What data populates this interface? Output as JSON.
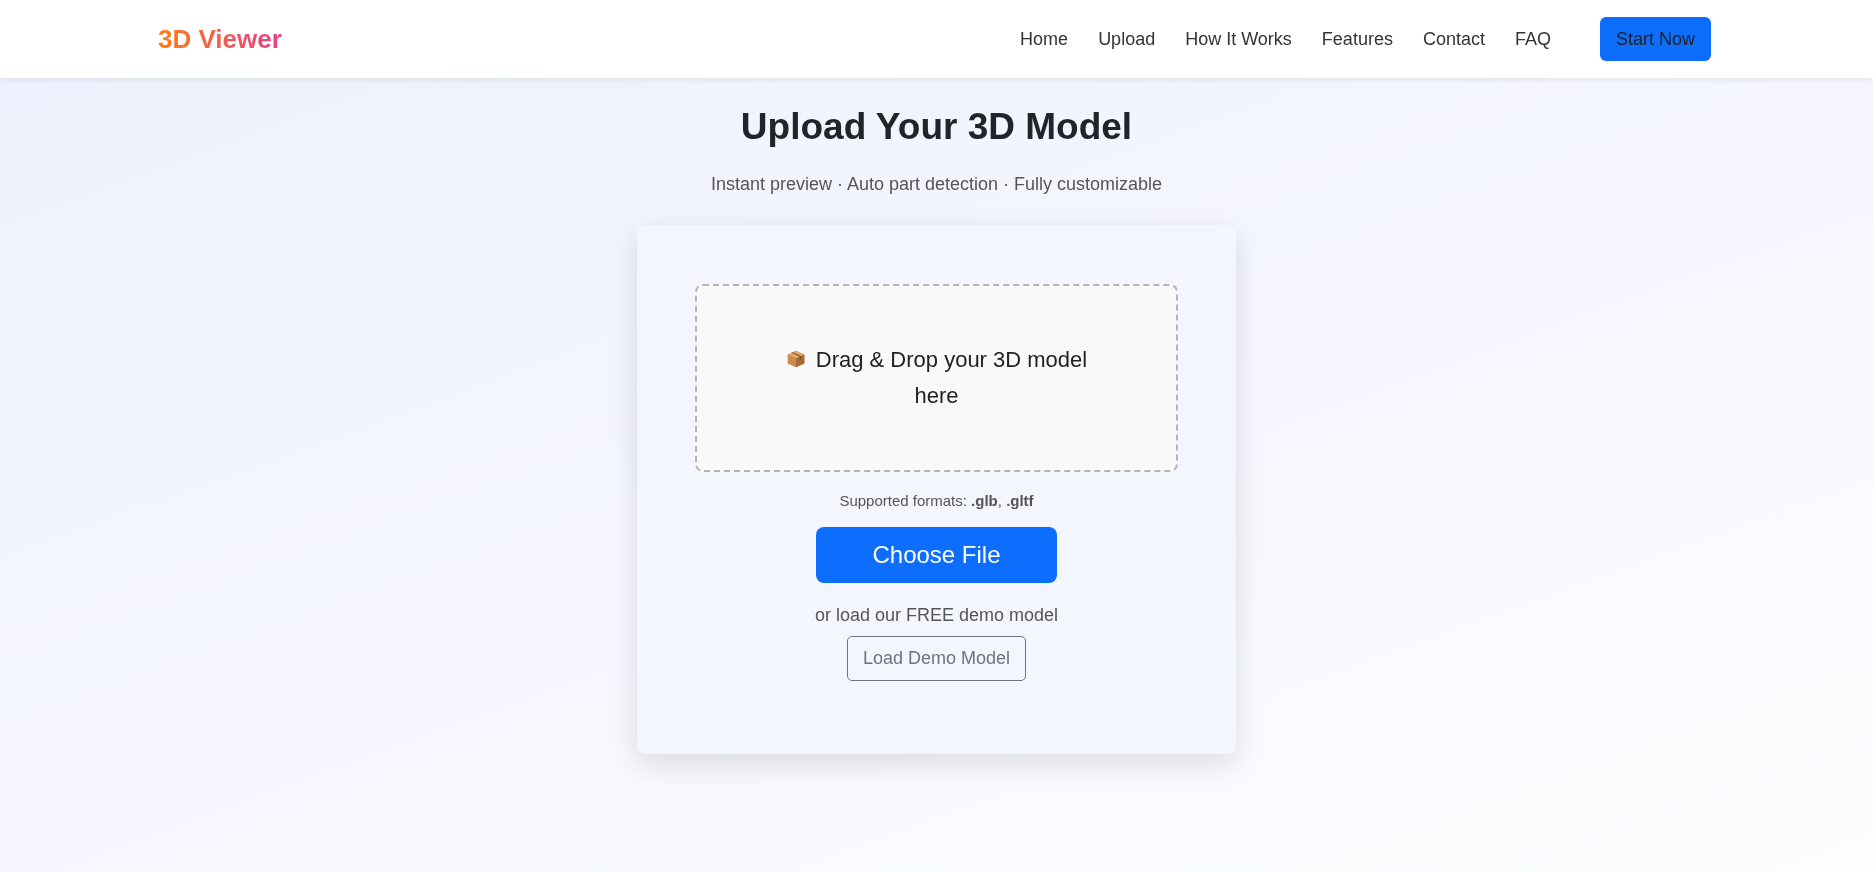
{
  "header": {
    "logo": "3D Viewer",
    "nav": [
      {
        "label": "Home"
      },
      {
        "label": "Upload"
      },
      {
        "label": "How It Works"
      },
      {
        "label": "Features"
      },
      {
        "label": "Contact"
      },
      {
        "label": "FAQ"
      }
    ],
    "cta": "Start Now"
  },
  "hero": {
    "title": "Upload Your 3D Model",
    "subtitle": "Instant preview · Auto part detection · Fully customizable"
  },
  "upload_card": {
    "drop_zone": {
      "text": "Drag & Drop your 3D model here"
    },
    "formats": "Supported formats: **.glb**, **.gltf**",
    "choose_button": "Choose File",
    "demo_text": "or load our FREE demo model",
    "demo_button": "Load Demo Model"
  }
}
